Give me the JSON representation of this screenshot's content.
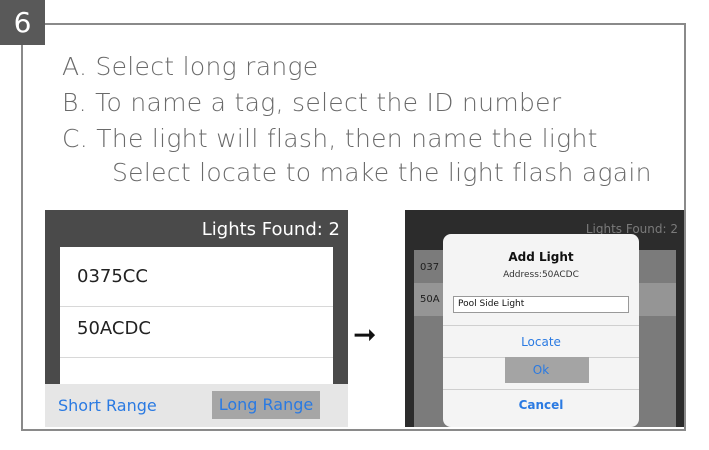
{
  "step": "6",
  "instructions": {
    "a": "A. Select long range",
    "b": "B. To name a tag, select the ID number",
    "c": "C. The light will flash, then name the light",
    "d": "Select locate to make the light flash again"
  },
  "left_screen": {
    "header": "Lights Found: 2",
    "items": [
      "0375CC",
      "50ACDC"
    ],
    "short_range_label": "Short Range",
    "long_range_label": "Long Range"
  },
  "arrow": "➞",
  "right_screen": {
    "header": "Lights Found: 2",
    "rows": [
      "037",
      "50A"
    ],
    "dialog": {
      "title": "Add Light",
      "subtitle": "Address:50ACDC",
      "input_value": "Pool Side Light",
      "locate_label": "Locate",
      "ok_label": "Ok",
      "cancel_label": "Cancel"
    }
  },
  "colors": {
    "accent_blue": "#2a7ae2",
    "badge_bg": "#595959",
    "panel_dark": "#4a4a4a"
  }
}
